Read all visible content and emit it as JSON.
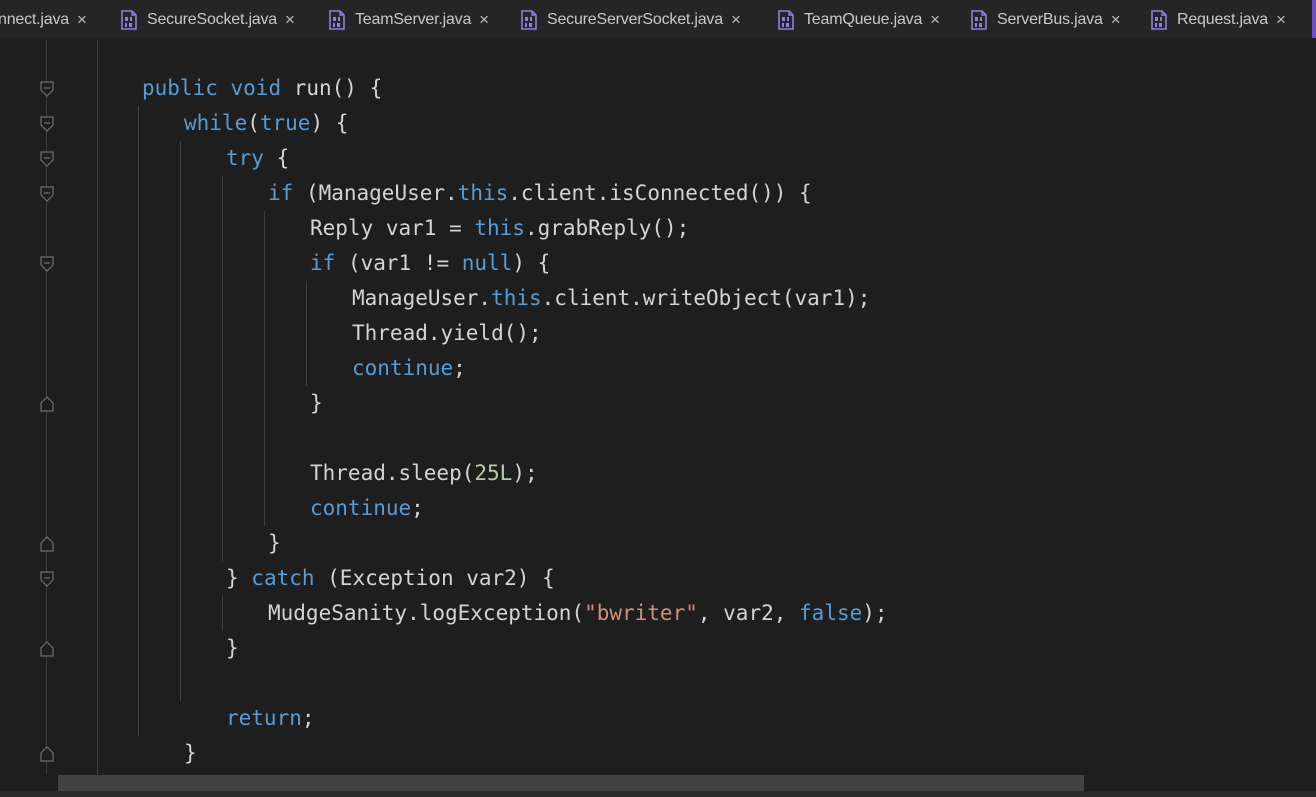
{
  "tabs": [
    {
      "label": "nnect.java",
      "icon": "java-class-file-icon",
      "has_icon": false
    },
    {
      "label": "SecureSocket.java",
      "icon": "java-class-file-icon",
      "has_icon": true
    },
    {
      "label": "TeamServer.java",
      "icon": "java-class-file-icon",
      "has_icon": true
    },
    {
      "label": "SecureServerSocket.java",
      "icon": "java-class-file-icon",
      "has_icon": true
    },
    {
      "label": "TeamQueue.java",
      "icon": "java-class-file-icon",
      "has_icon": true
    },
    {
      "label": "ServerBus.java",
      "icon": "java-class-file-icon",
      "has_icon": true
    },
    {
      "label": "Request.java",
      "icon": "java-class-file-icon",
      "has_icon": true
    }
  ],
  "tab_close_glyph": "×",
  "code_lines": [
    [
      {
        "t": "public ",
        "c": "kw"
      },
      {
        "t": "void ",
        "c": "kw"
      },
      {
        "t": "run() {",
        "c": ""
      }
    ],
    [
      {
        "t": "while",
        "c": "kw"
      },
      {
        "t": "(",
        "c": ""
      },
      {
        "t": "true",
        "c": "kw"
      },
      {
        "t": ") {",
        "c": ""
      }
    ],
    [
      {
        "t": "try",
        "c": "kw"
      },
      {
        "t": " {",
        "c": ""
      }
    ],
    [
      {
        "t": "if",
        "c": "kw"
      },
      {
        "t": " (ManageUser.",
        "c": ""
      },
      {
        "t": "this",
        "c": "kw"
      },
      {
        "t": ".client.isConnected()) {",
        "c": ""
      }
    ],
    [
      {
        "t": "Reply var1 = ",
        "c": ""
      },
      {
        "t": "this",
        "c": "kw"
      },
      {
        "t": ".grabReply();",
        "c": ""
      }
    ],
    [
      {
        "t": "if",
        "c": "kw"
      },
      {
        "t": " (var1 != ",
        "c": ""
      },
      {
        "t": "null",
        "c": "kw"
      },
      {
        "t": ") {",
        "c": ""
      }
    ],
    [
      {
        "t": "ManageUser.",
        "c": ""
      },
      {
        "t": "this",
        "c": "kw"
      },
      {
        "t": ".client.writeObject(var1);",
        "c": ""
      }
    ],
    [
      {
        "t": "Thread.yield();",
        "c": ""
      }
    ],
    [
      {
        "t": "continue",
        "c": "kw"
      },
      {
        "t": ";",
        "c": ""
      }
    ],
    [
      {
        "t": "}",
        "c": ""
      }
    ],
    [],
    [
      {
        "t": "Thread.sleep(",
        "c": ""
      },
      {
        "t": "25L",
        "c": "num"
      },
      {
        "t": ");",
        "c": ""
      }
    ],
    [
      {
        "t": "continue",
        "c": "kw"
      },
      {
        "t": ";",
        "c": ""
      }
    ],
    [
      {
        "t": "}",
        "c": ""
      }
    ],
    [
      {
        "t": "} ",
        "c": ""
      },
      {
        "t": "catch",
        "c": "kw"
      },
      {
        "t": " (Exception var2) {",
        "c": ""
      }
    ],
    [
      {
        "t": "MudgeSanity.logException(",
        "c": ""
      },
      {
        "t": "\"bwriter\"",
        "c": "str"
      },
      {
        "t": ", var2, ",
        "c": ""
      },
      {
        "t": "false",
        "c": "kw"
      },
      {
        "t": ");",
        "c": ""
      }
    ],
    [
      {
        "t": "}",
        "c": ""
      }
    ],
    [],
    [
      {
        "t": "return",
        "c": "kw"
      },
      {
        "t": ";",
        "c": ""
      }
    ],
    [
      {
        "t": "}",
        "c": ""
      }
    ]
  ],
  "colors": {
    "background": "#1e1e1e",
    "tabbar": "#252526",
    "keyword": "#569cd6",
    "string": "#ce9178",
    "number": "#b5cea8",
    "text": "#d4d4d4",
    "file_icon": "#8f7ee0"
  }
}
